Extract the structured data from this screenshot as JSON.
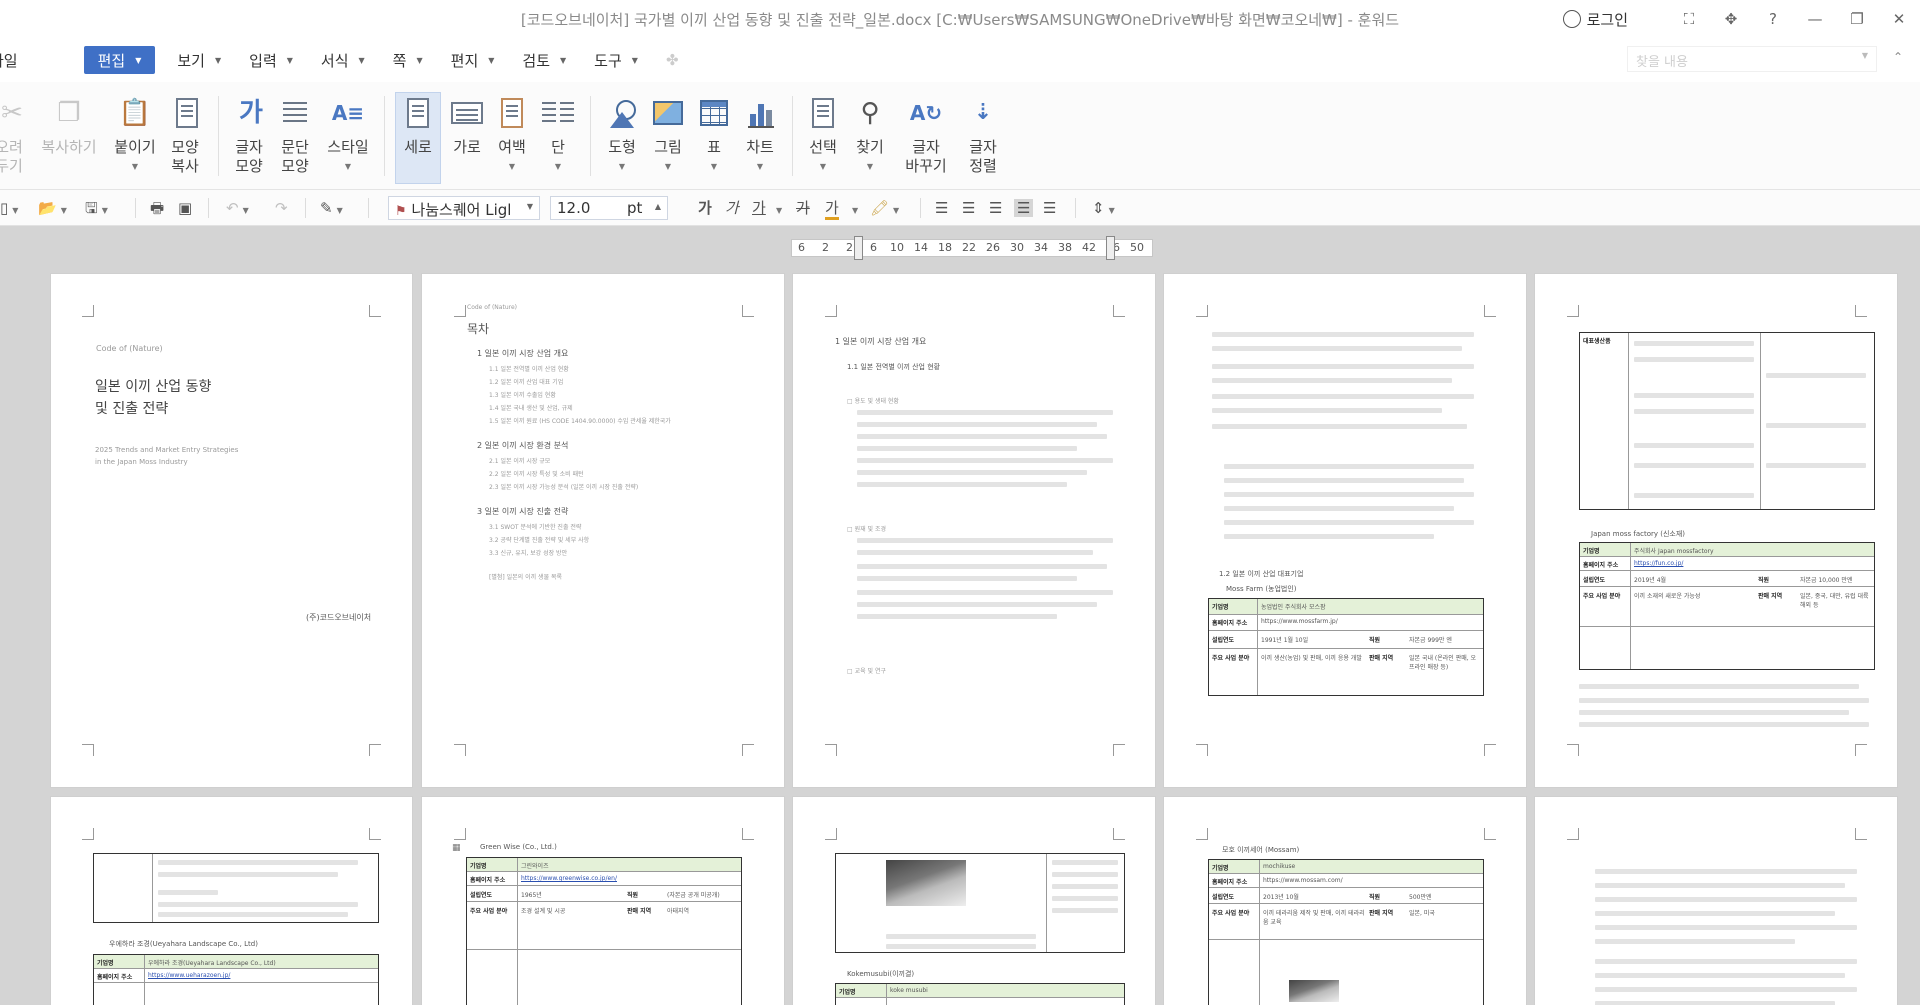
{
  "window": {
    "title": "[코드오브네이처] 국가별 이끼 산업 동향 및 진출 전략_일본.docx [C:₩Users₩SAMSUNG₩OneDrive₩바탕 화면₩코오네₩] - 훈워드",
    "login": "로그인",
    "help": "?"
  },
  "menu": {
    "items": [
      "파일",
      "편집",
      "보기",
      "입력",
      "서식",
      "쪽",
      "편지",
      "검토",
      "도구"
    ],
    "active_index": 1,
    "search_placeholder": "찾을 내용"
  },
  "ribbon": {
    "cut": "오려 두기",
    "copy": "복사하기",
    "paste": "붙이기",
    "format_copy": "모양 복사",
    "char_shape": "글자 모양",
    "para_shape": "문단 모양",
    "style": "스타일",
    "portrait": "세로",
    "landscape": "가로",
    "margin": "여백",
    "columns": "단",
    "shape": "도형",
    "picture": "그림",
    "table": "표",
    "chart": "차트",
    "select": "선택",
    "find": "찾기",
    "replace": "글자 바꾸기",
    "sort": "글자 정렬"
  },
  "toolbar": {
    "font": "나눔스퀘어 Ligl",
    "size": "12.0",
    "unit": "pt",
    "bold": "가",
    "italic": "가",
    "underline": "가",
    "strike": "가",
    "color": "가"
  },
  "ruler": {
    "ticks": [
      "6",
      "2",
      "2",
      "6",
      "10",
      "14",
      "18",
      "22",
      "26",
      "30",
      "34",
      "38",
      "42",
      "46",
      "50"
    ]
  },
  "pages": {
    "p1": {
      "logo": "Code of (Nature)",
      "title_line1": "일본 이끼 산업 동향",
      "title_line2": "및 진출 전략",
      "subtitle_line1": "2025 Trends and Market Entry Strategies",
      "subtitle_line2": "in the Japan Moss Industry",
      "company": "(주)코드오브네이처"
    },
    "p2": {
      "toc_title": "목차",
      "s1": "1  일본 이끼 시장 산업 개요",
      "s1_items": [
        "1.1  일본 전역별 이끼 산업 현황",
        "1.2  일본 이끼 산업 대표 기업",
        "1.3  일본 이끼 수출입 현황",
        "1.4  일본 국내 생산 및 산업, 규제",
        "1.5  일본 이끼 원료 (HS CODE 1404.90.0000) 수입 관세율 제한국가"
      ],
      "s2": "2  일본 이끼 시장 환경 분석",
      "s2_items": [
        "2.1  일본 이끼 시장 규모",
        "2.2  일본 이끼 시장 특성 및 소비 패턴",
        "2.3  일본 이끼 시장 가능성 분석 (일본 이끼 시장 진출 전략)"
      ],
      "s3": "3  일본 이끼 시장 진출 전략",
      "s3_items": [
        "3.1  SWOT 분석에 기반한 진출 전략",
        "3.2  공략 단계별 진출 전략 및 세부 사항",
        "3.3  신규, 유지, 보강 성장 방안"
      ],
      "appendix": "[별첨] 일본의 이끼 생물 목록"
    },
    "p3": {
      "h1": "1  일본 이끼 시장 산업 개요",
      "h2": "1.1  일본 전역별 이끼 산업 현황",
      "b1": "□ 용도 및 생태 현황",
      "b2": "□ 원재 및 조경",
      "b3": "□ 교육 및 연구"
    },
    "p4": {
      "h2": "1.2  일본 이끼 산업 대표기업",
      "company": "Moss Farm (농업법인)",
      "r1": "기업명",
      "r1v": "농업법인 주식회사 모스팜",
      "r2": "홈페이지 주소",
      "r2v": "https://www.mossfarm.jp/",
      "r3": "설립연도",
      "r3v": "1991년 1월 10일",
      "r3b": "직원",
      "r3bv": "자본금 999만 엔",
      "r4": "주요 사업 분야",
      "r4v": "이끼 생산(농업) 및 판매, 이끼 응용 개발",
      "r4b": "판매 지역",
      "r4bv": "일본 국내 (온라인 판매, 오프라인 매장 등)"
    },
    "p5": {
      "th": "대표생산품",
      "company": "Japan moss factory (신소재)",
      "r1": "기업명",
      "r1v": "주식회사 Japan mossfactory",
      "r2": "홈페이지 주소",
      "r2v": "https://fun.co.jp/",
      "r3": "설립연도",
      "r3v": "2019년 4월",
      "r3b": "직원",
      "r3bv": "자본금 10,000 만엔",
      "r4": "주요 사업 분야",
      "r4v": "이끼 소재의 새로운 가능성",
      "r4b": "판매 지역",
      "r4bv": "일본, 중국, 대만, 유럽 대륙 해외 등"
    },
    "p6": {
      "company": "우에하라 조경(Ueyahara Landscape Co., Ltd)",
      "r1": "기업명",
      "r1v": "우에하라 조경(Ueyahara Landscape Co., Ltd)",
      "r2": "홈페이지 주소",
      "r2v": "https://www.ueharazoen.jp/"
    },
    "p7": {
      "company": "Green Wise (Co., Ltd.)",
      "r1": "기업명",
      "r1v": "그린와이즈",
      "r2": "홈페이지 주소",
      "r2v": "https://www.greenwise.co.jp/en/",
      "r3": "설립연도",
      "r3v": "1965년",
      "r3b": "직원",
      "r3bv": "(자본금 공개 미공개)",
      "r4": "주요 사업 분야",
      "r4v": "조경 설계 및 시공",
      "r4b": "판매 지역",
      "r4bv": "아태지역"
    },
    "p8": {
      "company": "Kokemusubi(이끼결)",
      "r1": "기업명",
      "r1v": "koke musubi"
    },
    "p9": {
      "company": "모호 이끼세어 (Mossam)",
      "r1": "기업명",
      "r1v": "mochikuse",
      "r2": "홈페이지 주소",
      "r2v": "https://www.mossam.com/",
      "r3": "설립연도",
      "r3v": "2013년 10월",
      "r3b": "직원",
      "r3bv": "500만엔",
      "r4": "주요 사업 분야",
      "r4v": "이끼 테라리움 제작 및 판매, 이끼 테라리움 교육",
      "r4b": "판매 지역",
      "r4bv": "일본, 미국"
    }
  }
}
